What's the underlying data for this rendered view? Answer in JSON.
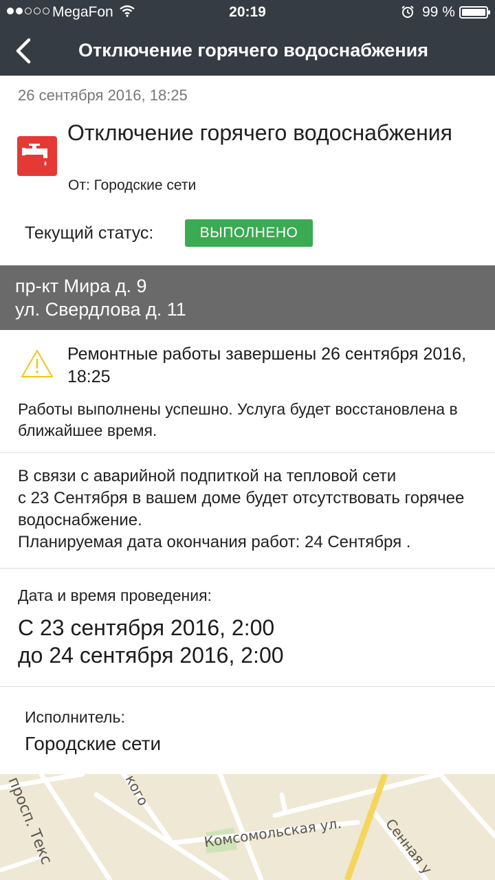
{
  "status_bar": {
    "carrier": "MegaFon",
    "time": "20:19",
    "battery": "99 %",
    "battery_level": 0.99
  },
  "nav": {
    "title": "Отключение горячего водоснабжения"
  },
  "notice": {
    "date": "26 сентября 2016, 18:25",
    "title": "Отключение горячего водоснабжения",
    "from": "От: Городские сети",
    "status_label": "Текущий статус:",
    "status_value": "ВЫПОЛНЕНО",
    "status_color": "#3aaa53"
  },
  "address": {
    "line1": "пр-кт Мира д. 9",
    "line2": "ул. Свердлова д. 11"
  },
  "update": {
    "title": "Ремонтные работы завершены 26 сентября 2016, 18:25",
    "text": "Работы выполнены успешно. Услуга будет восстановлена в ближайшее время."
  },
  "description": "В связи с аварийной подпиткой на тепловой сети\nс 23 Сентября  в вашем доме будет отсутствовать горячее водоснабжение.\nПланируемая дата окончания работ: 24 Сентября .",
  "period": {
    "label": "Дата и время проведения:",
    "from": "С 23 сентября 2016, 2:00",
    "to": "до 24 сентября 2016, 2:00"
  },
  "executor": {
    "label": "Исполнитель:",
    "value": "Городские сети"
  },
  "map": {
    "labels": [
      "просп. Текс",
      "кого",
      "Комсомольская ул.",
      "Сенная у"
    ]
  },
  "icons": {
    "back": "chevron-left-icon",
    "tap": "water-tap-icon",
    "warning": "warning-triangle-icon"
  }
}
